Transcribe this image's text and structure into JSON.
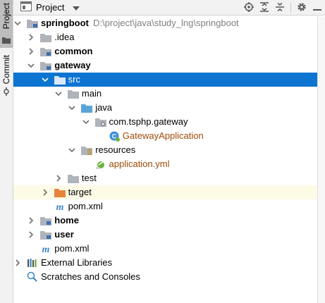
{
  "stripe": {
    "project_label": "Project",
    "commit_label": "Commit"
  },
  "header": {
    "title": "Project",
    "actions": [
      "locate-icon",
      "expand-all-icon",
      "collapse-all-icon",
      "settings-icon",
      "hide-icon"
    ]
  },
  "tree": {
    "rows": [
      {
        "label": "springboot",
        "path": "D:\\project\\java\\study_lng\\springboot",
        "icon": "module-folder",
        "bold": true,
        "expanded": true,
        "depth": 0
      },
      {
        "label": ".idea",
        "icon": "folder",
        "expanded": false,
        "depth": 1
      },
      {
        "label": "common",
        "icon": "module-folder",
        "bold": true,
        "expanded": false,
        "depth": 1
      },
      {
        "label": "gateway",
        "icon": "module-folder",
        "bold": true,
        "expanded": true,
        "depth": 1
      },
      {
        "label": "src",
        "icon": "folder",
        "expanded": true,
        "depth": 2,
        "selected": true
      },
      {
        "label": "main",
        "icon": "folder",
        "expanded": true,
        "depth": 3
      },
      {
        "label": "java",
        "icon": "source-folder",
        "expanded": true,
        "depth": 4
      },
      {
        "label": "com.tsphp.gateway",
        "icon": "package",
        "expanded": true,
        "depth": 5
      },
      {
        "label": "GatewayApplication",
        "icon": "spring-class",
        "depth": 6,
        "modified": true
      },
      {
        "label": "resources",
        "icon": "resources-folder",
        "expanded": true,
        "depth": 4
      },
      {
        "label": "application.yml",
        "icon": "yml-file",
        "depth": 5,
        "modified": true
      },
      {
        "label": "test",
        "icon": "folder",
        "expanded": false,
        "depth": 3
      },
      {
        "label": "target",
        "icon": "excluded-folder",
        "expanded": false,
        "depth": 2,
        "highlight": true
      },
      {
        "label": "pom.xml",
        "icon": "maven-file",
        "depth": 2
      },
      {
        "label": "home",
        "icon": "module-folder",
        "bold": true,
        "expanded": false,
        "depth": 1
      },
      {
        "label": "user",
        "icon": "module-folder",
        "bold": true,
        "expanded": false,
        "depth": 1
      },
      {
        "label": "pom.xml",
        "icon": "maven-file",
        "depth": 1
      },
      {
        "label": "External Libraries",
        "icon": "libraries",
        "expanded": false,
        "depth": 0
      },
      {
        "label": "Scratches and Consoles",
        "icon": "scratches",
        "depth": 0
      }
    ]
  },
  "colors": {
    "selection": "#0d74d1",
    "modified": "#9e4a06",
    "folder": "#aeb4ba",
    "source_folder": "#5aa4d8",
    "excluded_folder": "#e8843a",
    "highlight_row": "#fdfbe6"
  }
}
